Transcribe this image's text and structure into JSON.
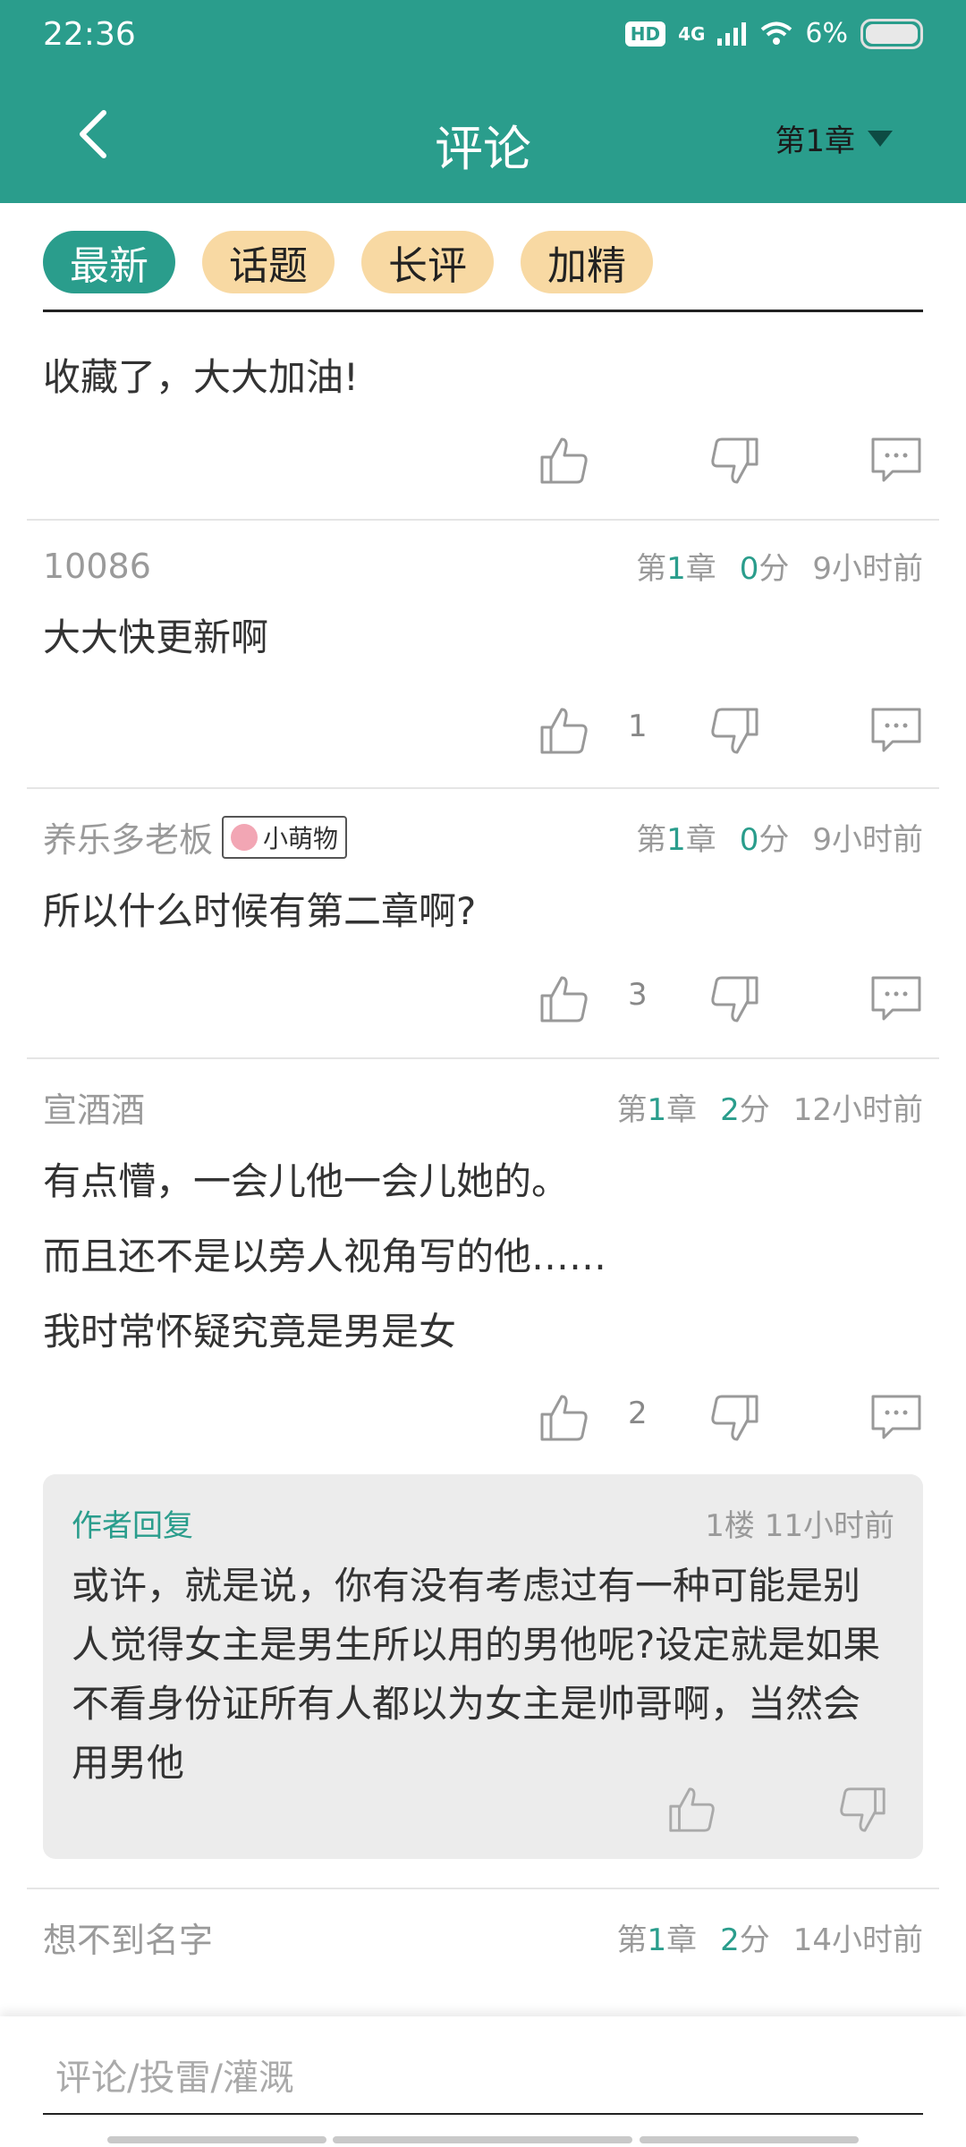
{
  "status": {
    "time": "22:36",
    "hd": "HD",
    "network": "4G",
    "battery": "6%"
  },
  "header": {
    "title": "评论",
    "chapter": "第1章"
  },
  "tabs": [
    "最新",
    "话题",
    "长评",
    "加精"
  ],
  "comments": [
    {
      "text": [
        "收藏了，大大加油!"
      ]
    },
    {
      "user": "10086",
      "chapter_prefix": "第",
      "chapter_num": "1",
      "chapter_suffix": "章",
      "score": "0",
      "score_unit": "分",
      "time": "9小时前",
      "text": [
        "大大快更新啊"
      ],
      "likes": "1"
    },
    {
      "user": "养乐多老板",
      "badge": "小萌物",
      "chapter_prefix": "第",
      "chapter_num": "1",
      "chapter_suffix": "章",
      "score": "0",
      "score_unit": "分",
      "time": "9小时前",
      "text": [
        "所以什么时候有第二章啊?"
      ],
      "likes": "3"
    },
    {
      "user": "宣酒酒",
      "chapter_prefix": "第",
      "chapter_num": "1",
      "chapter_suffix": "章",
      "score": "2",
      "score_unit": "分",
      "time": "12小时前",
      "text": [
        "有点懵，一会儿他一会儿她的。",
        "而且还不是以旁人视角写的他……",
        "我时常怀疑究竟是男是女"
      ],
      "likes": "2"
    },
    {
      "user": "想不到名字",
      "chapter_prefix": "第",
      "chapter_num": "1",
      "chapter_suffix": "章",
      "score": "2",
      "score_unit": "分",
      "time": "14小时前"
    }
  ],
  "author_reply": {
    "label": "作者回复",
    "floor": "1楼",
    "time": "11小时前",
    "text": "或许，就是说，你有没有考虑过有一种可能是别人觉得女主是男生所以用的男他呢?设定就是如果不看身份证所有人都以为女主是帅哥啊，当然会用男他"
  },
  "input": {
    "placeholder": "评论/投雷/灌溉"
  },
  "colors": {
    "accent": "#2a9d8c",
    "tab_inactive": "#f8d9a3"
  },
  "icons": [
    "back-icon",
    "thumbs-up-icon",
    "thumbs-down-icon",
    "reply-bubble-icon"
  ]
}
